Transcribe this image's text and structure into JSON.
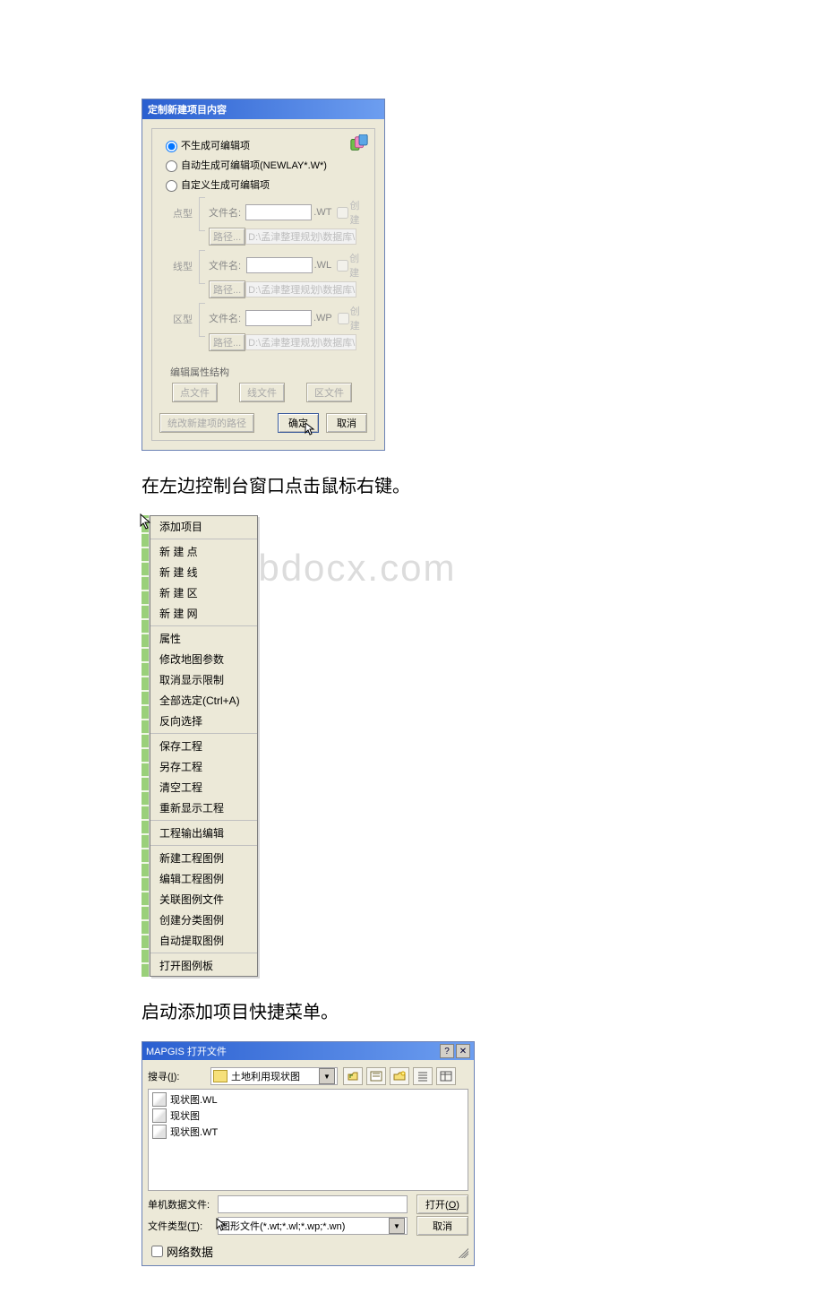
{
  "watermark": "www.bdocx.com",
  "dlg1": {
    "title": "定制新建项目内容",
    "radio_no_edit": "不生成可编辑项",
    "radio_auto": "自动生成可编辑项(NEWLAY*.W*)",
    "radio_custom": "自定义生成可编辑项",
    "type_point": "点型",
    "type_line": "线型",
    "type_region": "区型",
    "file_label": "文件名:",
    "path_btn": "路径...",
    "path_placeholder": "D:\\孟津整理规划\\数据库\\",
    "ext_point": ".WT",
    "ext_line": ".WL",
    "ext_region": ".WP",
    "chk_create": "创建",
    "edit_attr_title": "编辑属性结构",
    "btn_point_file": "点文件",
    "btn_line_file": "线文件",
    "btn_region_file": "区文件",
    "btn_unify_path": "统改新建项的路径",
    "btn_ok": "确定",
    "btn_cancel": "取消"
  },
  "para1": "在左边控制台窗口点击鼠标右键。",
  "ctx": {
    "items_g1": [
      "添加项目"
    ],
    "items_g2": [
      "新 建 点",
      "新 建 线",
      "新 建 区",
      "新 建 网"
    ],
    "items_g3": [
      "属性",
      "修改地图参数",
      "取消显示限制",
      "全部选定(Ctrl+A)",
      "反向选择"
    ],
    "items_g4": [
      "保存工程",
      "另存工程",
      "清空工程",
      "重新显示工程"
    ],
    "items_g5": [
      "工程输出编辑"
    ],
    "items_g6": [
      "新建工程图例",
      "编辑工程图例",
      "关联图例文件",
      "创建分类图例",
      "自动提取图例"
    ],
    "items_g7": [
      "打开图例板"
    ]
  },
  "para2": "启动添加项目快捷菜单。",
  "openDlg": {
    "title": "MAPGIS 打开文件",
    "search_label_pre": "搜寻(",
    "search_label_key": "I",
    "search_label_post": "):",
    "folder_name": "土地利用现状图",
    "files": [
      "现状图.WL",
      "现状图",
      "现状图.WT"
    ],
    "single_label": "单机数据文件:",
    "type_label_pre": "文件类型(",
    "type_label_key": "T",
    "type_label_post": "):",
    "type_value": "图形文件(*.wt;*.wl;*.wp;*.wn)",
    "btn_open_pre": "打开(",
    "btn_open_key": "O",
    "btn_open_post": ")",
    "btn_cancel": "取消",
    "net_label": "网络数据",
    "help_sym": "?",
    "close_sym": "✕"
  }
}
